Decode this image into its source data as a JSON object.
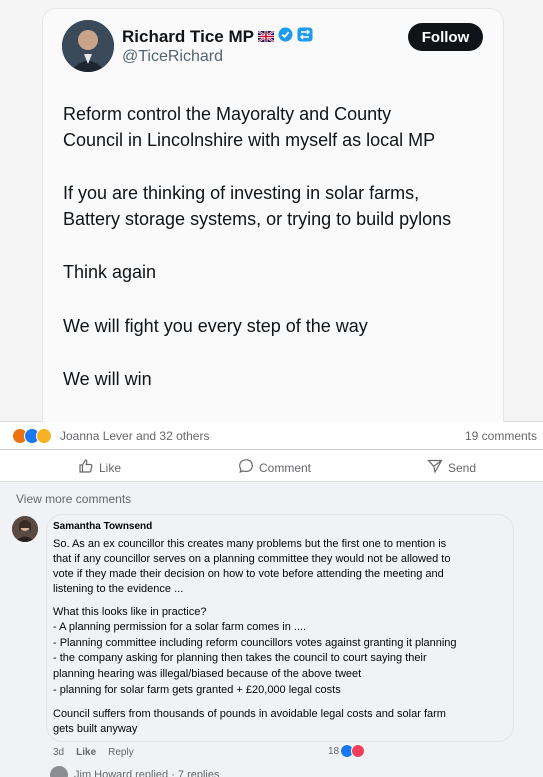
{
  "tweet": {
    "author_name": "Richard Tice MP",
    "handle": "@TiceRichard",
    "follow_label": "Follow",
    "lines": [
      "Reform control the Mayoralty and County",
      "Council in Lincolnshire with myself as local MP",
      "If you are thinking of investing in solar farms,",
      "Battery storage systems, or trying to build pylons",
      "Think again",
      "We will fight you every step of the way",
      "We will win"
    ]
  },
  "post": {
    "reactors": "Joanna Lever and 32 others",
    "comment_count": "19 comments",
    "actions": {
      "like": "Like",
      "comment": "Comment",
      "send": "Send"
    },
    "view_more": "View more comments"
  },
  "comment": {
    "author": "Samantha Townsend",
    "lines": [
      "So. As an ex councillor this creates many problems but the first one to mention is",
      "that if any councillor serves on a planning committee they would not be allowed to",
      "vote if they made their decision on how to vote before attending the meeting and",
      "listening to the evidence ...",
      "What this looks like in practice?",
      "- A planning permission for a solar farm comes in ....",
      "- Planning committee including reform councillors votes against granting it planning",
      "- the company asking for planning then takes the council to court saying their",
      "planning hearing was illegal/biased because of the above tweet",
      "- planning for solar farm gets granted + £20,000 legal costs",
      "Council suffers from thousands of pounds in avoidable legal costs and solar farm",
      "gets built anyway"
    ],
    "age": "3d",
    "like_label": "Like",
    "reply_label": "Reply",
    "reaction_count": "18"
  },
  "replies_label": "Jim Howard replied · 7 replies",
  "colors": {
    "facebook_blue": "#1877f2",
    "love_red": "#f33e58",
    "haha_yellow": "#f7b125",
    "x_black": "#0f1419"
  },
  "icons": [
    "verified-badge-icon",
    "uk-flag-icon",
    "like-icon",
    "comment-icon",
    "send-icon"
  ]
}
